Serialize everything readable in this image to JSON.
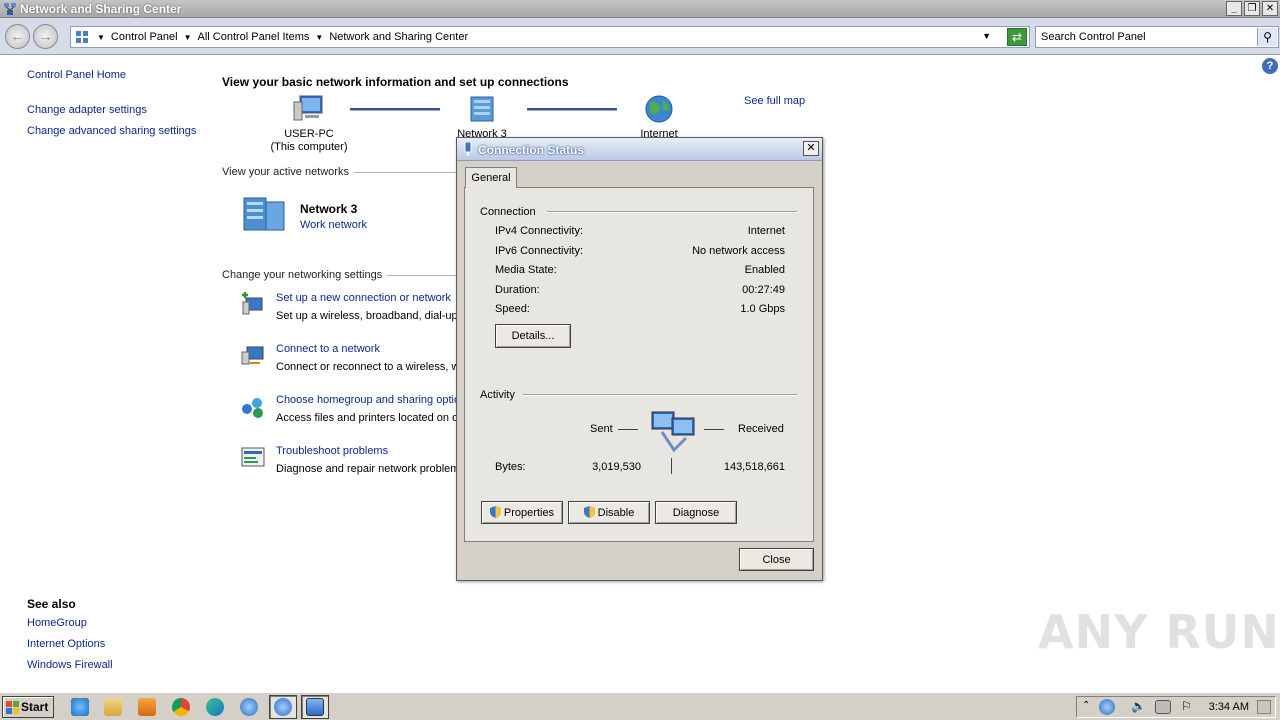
{
  "window": {
    "title": "Network and Sharing Center"
  },
  "address": {
    "crumbs": [
      "Control Panel",
      "All Control Panel Items",
      "Network and Sharing Center"
    ],
    "search_placeholder": "Search Control Panel"
  },
  "left_pane": {
    "home": "Control Panel Home",
    "links": [
      "Change adapter settings",
      "Change advanced sharing settings"
    ]
  },
  "see_also": {
    "heading": "See also",
    "links": [
      "HomeGroup",
      "Internet Options",
      "Windows Firewall"
    ]
  },
  "main": {
    "title": "View your basic network information and set up connections",
    "map": {
      "computer_name": "USER-PC",
      "computer_sub": "(This computer)",
      "network": "Network  3",
      "internet": "Internet",
      "see_full_map": "See full map"
    },
    "active_networks_heading": "View your active networks",
    "active_network": {
      "name": "Network  3",
      "type": "Work network"
    },
    "settings_heading": "Change your networking settings",
    "tasks": [
      {
        "link": "Set up a new connection or network",
        "desc": "Set up a wireless, broadband, dial-up"
      },
      {
        "link": "Connect to a network",
        "desc": "Connect or reconnect to a wireless, w"
      },
      {
        "link": "Choose homegroup and sharing optio",
        "desc": "Access files and printers located on ot"
      },
      {
        "link": "Troubleshoot problems",
        "desc": "Diagnose and repair network problem"
      }
    ]
  },
  "dialog": {
    "title": "Connection Status",
    "tab": "General",
    "connection_heading": "Connection",
    "rows": [
      {
        "label": "IPv4 Connectivity:",
        "value": "Internet"
      },
      {
        "label": "IPv6 Connectivity:",
        "value": "No network access"
      },
      {
        "label": "Media State:",
        "value": "Enabled"
      },
      {
        "label": "Duration:",
        "value": "00:27:49"
      },
      {
        "label": "Speed:",
        "value": "1.0 Gbps"
      }
    ],
    "details_button": "Details...",
    "activity_heading": "Activity",
    "sent_label": "Sent",
    "received_label": "Received",
    "bytes_label": "Bytes:",
    "bytes_sent": "3,019,530",
    "bytes_received": "143,518,661",
    "properties_button": "Properties",
    "disable_button": "Disable",
    "diagnose_button": "Diagnose",
    "close_button": "Close"
  },
  "taskbar": {
    "start": "Start",
    "clock": "3:34 AM"
  },
  "watermark": "ANY RUN"
}
